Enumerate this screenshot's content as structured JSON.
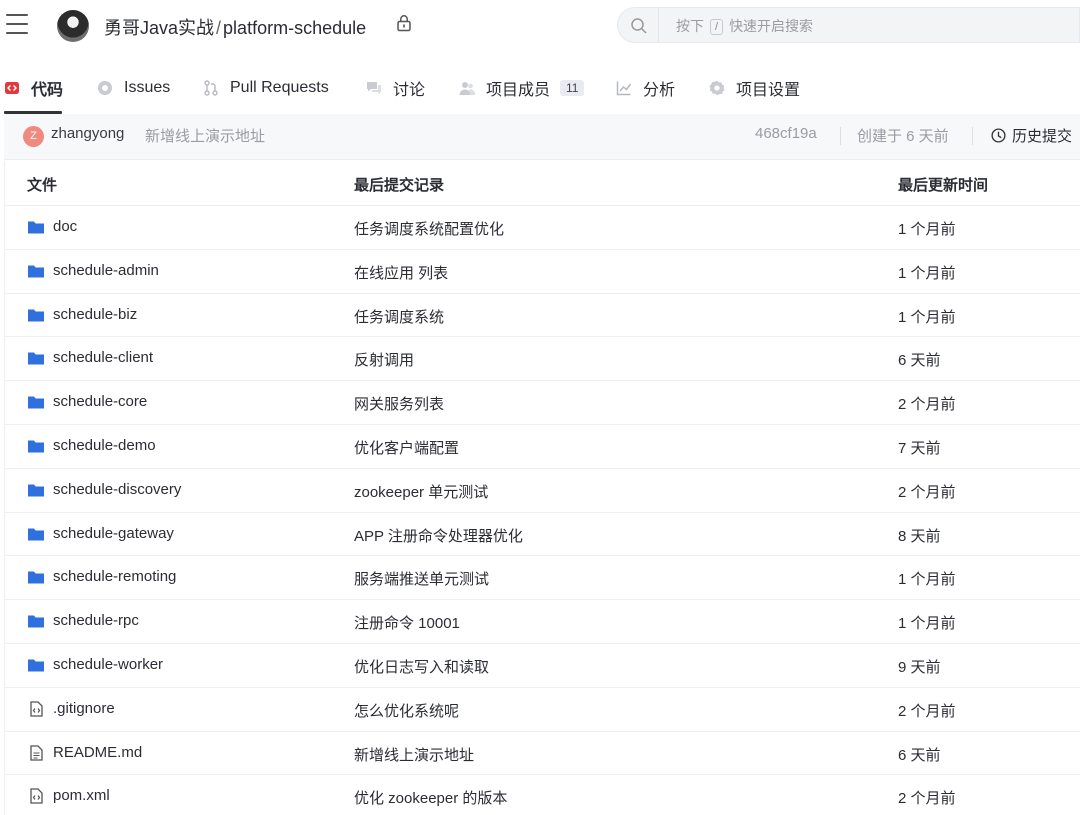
{
  "header": {
    "owner": "勇哥Java实战",
    "separator": "/",
    "repo": "platform-schedule",
    "search": {
      "prefix": "按下",
      "key": "/",
      "suffix": "快速开启搜索"
    }
  },
  "tabs": [
    {
      "label": "代码",
      "icon": "code-icon",
      "active": true
    },
    {
      "label": "Issues",
      "icon": "issues-icon"
    },
    {
      "label": "Pull Requests",
      "icon": "pull-request-icon"
    },
    {
      "label": "讨论",
      "icon": "discussion-icon"
    },
    {
      "label": "项目成员",
      "icon": "members-icon",
      "badge": "11"
    },
    {
      "label": "分析",
      "icon": "analytics-icon"
    },
    {
      "label": "项目设置",
      "icon": "gear-icon"
    }
  ],
  "commit": {
    "avatar_letter": "Z",
    "author": "zhangyong",
    "message": "新增线上演示地址",
    "hash": "468cf19a",
    "created": "创建于 6 天前",
    "history_label": "历史提交"
  },
  "table": {
    "headers": {
      "file": "文件",
      "commit": "最后提交记录",
      "updated": "最后更新时间"
    },
    "rows": [
      {
        "type": "folder",
        "name": "doc",
        "message": "任务调度系统配置优化",
        "time": "1 个月前"
      },
      {
        "type": "folder",
        "name": "schedule-admin",
        "message": "在线应用 列表",
        "time": "1 个月前"
      },
      {
        "type": "folder",
        "name": "schedule-biz",
        "message": "任务调度系统",
        "time": "1 个月前"
      },
      {
        "type": "folder",
        "name": "schedule-client",
        "message": "反射调用",
        "time": "6 天前"
      },
      {
        "type": "folder",
        "name": "schedule-core",
        "message": "网关服务列表",
        "time": "2 个月前"
      },
      {
        "type": "folder",
        "name": "schedule-demo",
        "message": "优化客户端配置",
        "time": "7 天前"
      },
      {
        "type": "folder",
        "name": "schedule-discovery",
        "message": "zookeeper 单元测试",
        "time": "2 个月前"
      },
      {
        "type": "folder",
        "name": "schedule-gateway",
        "message": "APP 注册命令处理器优化",
        "time": "8 天前"
      },
      {
        "type": "folder",
        "name": "schedule-remoting",
        "message": "服务端推送单元测试",
        "time": "1 个月前"
      },
      {
        "type": "folder",
        "name": "schedule-rpc",
        "message": "注册命令 10001",
        "time": "1 个月前"
      },
      {
        "type": "folder",
        "name": "schedule-worker",
        "message": "优化日志写入和读取",
        "time": "9 天前"
      },
      {
        "type": "code",
        "name": ".gitignore",
        "message": "怎么优化系统呢",
        "time": "2 个月前"
      },
      {
        "type": "doc",
        "name": "README.md",
        "message": "新增线上演示地址",
        "time": "6 天前"
      },
      {
        "type": "code",
        "name": "pom.xml",
        "message": "优化 zookeeper 的版本",
        "time": "2 个月前"
      }
    ]
  },
  "colors": {
    "folder": "#2f6fde",
    "code_tab": "#e0393e",
    "avatar": "#f08a80"
  }
}
